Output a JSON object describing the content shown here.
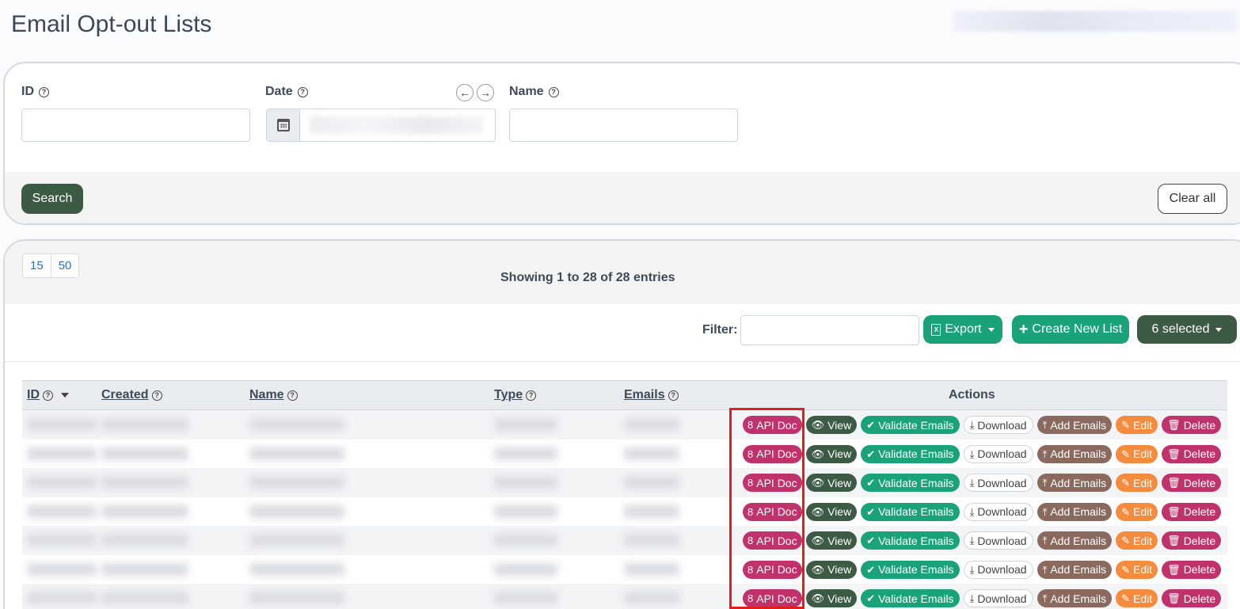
{
  "page": {
    "title": "Email Opt-out Lists"
  },
  "search_form": {
    "id_label": "ID",
    "date_label": "Date",
    "name_label": "Name",
    "help_glyph": "?",
    "prev_glyph": "←",
    "next_glyph": "→",
    "search_label": "Search",
    "clear_label": "Clear all"
  },
  "list": {
    "page_sizes": [
      "15",
      "50"
    ],
    "showing_text": "Showing 1 to 28 of 28 entries",
    "filter_label": "Filter:",
    "export_label": "Export",
    "export_icon": "X",
    "create_label": "Create New List",
    "create_icon": "+",
    "selected_label": "6 selected"
  },
  "table": {
    "columns": [
      "ID",
      "Created",
      "Name",
      "Type",
      "Emails",
      "Actions"
    ],
    "actions": {
      "api_doc": "API Doc",
      "view": "View",
      "validate": "Validate Emails",
      "download": "Download",
      "add_emails": "Add Emails",
      "edit": "Edit",
      "delete": "Delete"
    },
    "action_icons": {
      "api_doc": "8",
      "view": "👁",
      "validate": "✔",
      "download": "⤓",
      "add_emails": "⤒",
      "edit": "✎",
      "delete": "🗑"
    },
    "row_count_visible": 7
  },
  "colors": {
    "primary_dark": "#3c5a44",
    "success": "#1aa37a",
    "danger_pink": "#c0326b",
    "brown": "#8a6a5e",
    "warning": "#f58b3c",
    "highlight": "#e11d1d"
  }
}
